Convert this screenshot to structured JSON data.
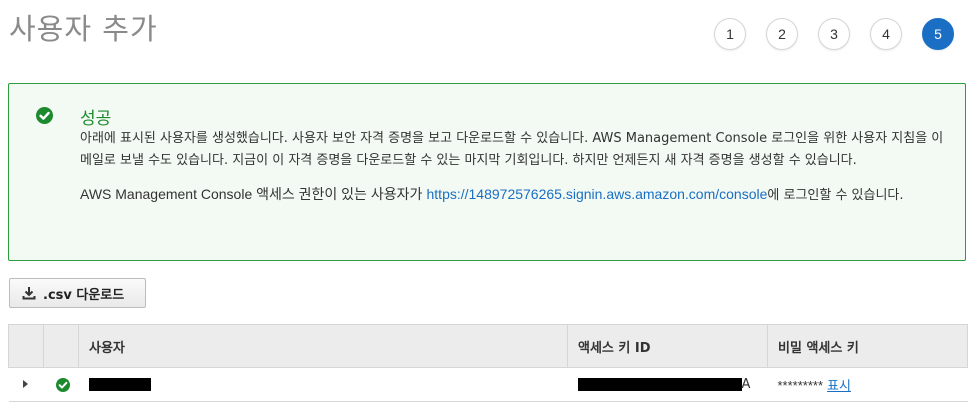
{
  "page": {
    "title": "사용자 추가"
  },
  "steps": [
    {
      "label": "1",
      "active": false
    },
    {
      "label": "2",
      "active": false
    },
    {
      "label": "3",
      "active": false
    },
    {
      "label": "4",
      "active": false
    },
    {
      "label": "5",
      "active": true
    }
  ],
  "success": {
    "title": "성공",
    "message": "아래에 표시된 사용자를 생성했습니다. 사용자 보안 자격 증명을 보고 다운로드할 수 있습니다. AWS Management Console 로그인을 위한 사용자 지침을 이메일로 보낼 수도 있습니다. 지금이 이 자격 증명을 다운로드할 수 있는 마지막 기회입니다. 하지만 언제든지 새 자격 증명을 생성할 수 있습니다.",
    "console_prefix": "AWS Management Console 액세스 권한이 있는 사용자가",
    "console_url": "https://148972576265.signin.aws.amazon.com/console",
    "console_suffix": "에 로그인할 수 있습니다."
  },
  "csv_button": {
    "label": ".csv 다운로드",
    "icon": "download-icon"
  },
  "table": {
    "headers": [
      "",
      "",
      "사용자",
      "액세스 키 ID",
      "비밀 액세스 키"
    ],
    "rows": [
      {
        "user": "",
        "access_key_suffix": "A",
        "secret": "*********",
        "show_label": "표시"
      }
    ]
  },
  "colors": {
    "primary": "#1a6fc4",
    "success": "#1d8a2e",
    "success_bg": "#f3faf3"
  }
}
